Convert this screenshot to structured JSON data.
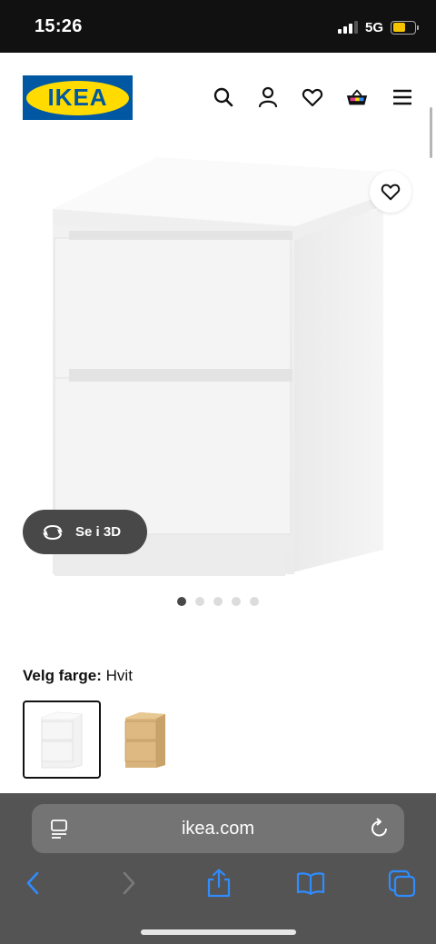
{
  "status_bar": {
    "time": "15:26",
    "network": "5G",
    "battery_level": 0.6
  },
  "header": {
    "logo_text": "IKEA",
    "icons": [
      "search-icon",
      "account-icon",
      "favorites-icon",
      "cart-icon",
      "menu-icon"
    ]
  },
  "product": {
    "image_count": 5,
    "active_image_index": 0,
    "view_3d_label": "Se i 3D"
  },
  "color_selection": {
    "label": "Velg farge:",
    "value": "Hvit",
    "options": [
      "Hvit",
      "Eikefiner"
    ],
    "selected_index": 0
  },
  "browser": {
    "url": "ikea.com"
  },
  "colors": {
    "ikea_blue": "#0058a3",
    "ikea_yellow": "#ffdb00",
    "safari_bar": "#545454",
    "accent_blue": "#2f8cff"
  }
}
